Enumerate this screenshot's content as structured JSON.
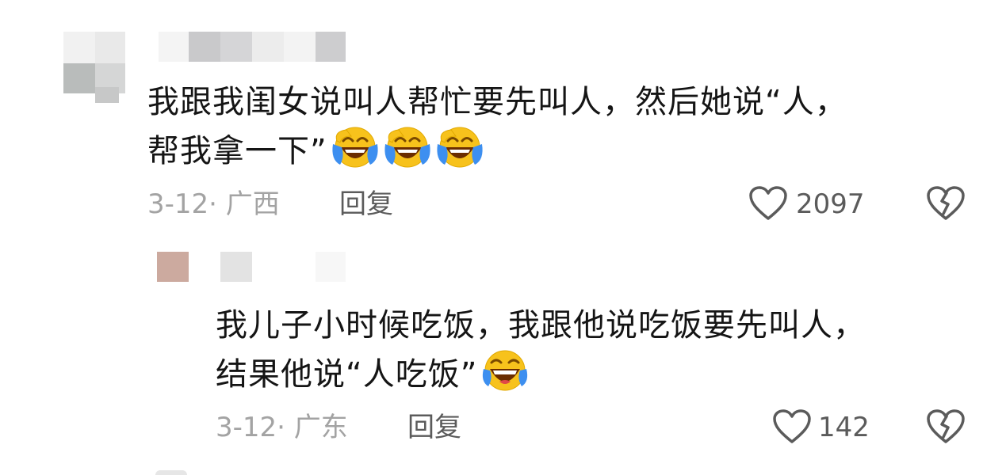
{
  "comments": [
    {
      "line1": "我跟我闺女说叫人帮忙要先叫人，然后她说“人，",
      "line2": "帮我拿一下”",
      "emoji_count": 3,
      "date_location": "3-12· 广西",
      "reply_label": "回复",
      "likes": "2097"
    },
    {
      "line1": "我儿子小时候吃饭，我跟他说吃饭要先叫人，",
      "line2": "结果他说“人吃饭”",
      "emoji_count": 1,
      "date_location": "3-12· 广东",
      "reply_label": "回复",
      "likes": "142"
    }
  ],
  "icons": {
    "like": "heart-outline-icon",
    "dislike": "broken-heart-icon",
    "laugh_cry": "face-with-tears-of-joy-icon",
    "laugh": "laughing-face-icon"
  },
  "colors": {
    "text": "#151515",
    "meta": "#a3a3a3",
    "action": "#5b5b5b",
    "emoji_face": "#f7c21c",
    "emoji_tear": "#3d8ff0"
  }
}
